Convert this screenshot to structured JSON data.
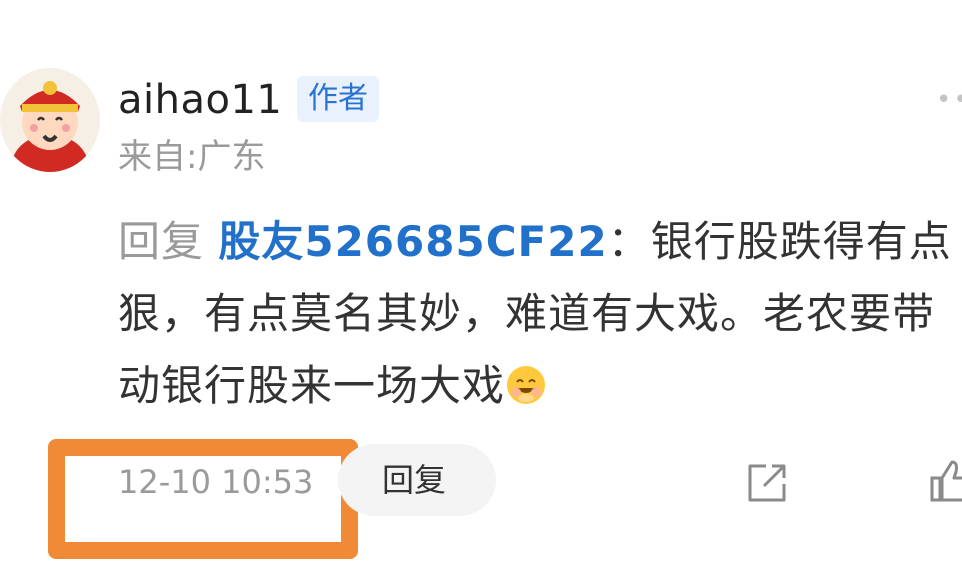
{
  "comment": {
    "username": "aihao11",
    "author_badge": "作者",
    "location": "来自:广东",
    "reply_prefix": "回复 ",
    "mention": "股友526685CF22",
    "separator": "：",
    "text": "银行股跌得有点狠，有点莫名其妙，难道有大戏。老农要带动银行股来一场大戏",
    "emoji": "grinning-face-emoji",
    "timestamp": "12-10 10:53",
    "reply_label": "回复"
  },
  "icons": {
    "more": "more-dots-icon",
    "share": "share-icon",
    "like": "thumbs-up-icon"
  },
  "colors": {
    "accent": "#2170c9",
    "badge_bg": "#e8f1fc",
    "highlight": "#f08a36",
    "muted": "#9a9a9a"
  }
}
